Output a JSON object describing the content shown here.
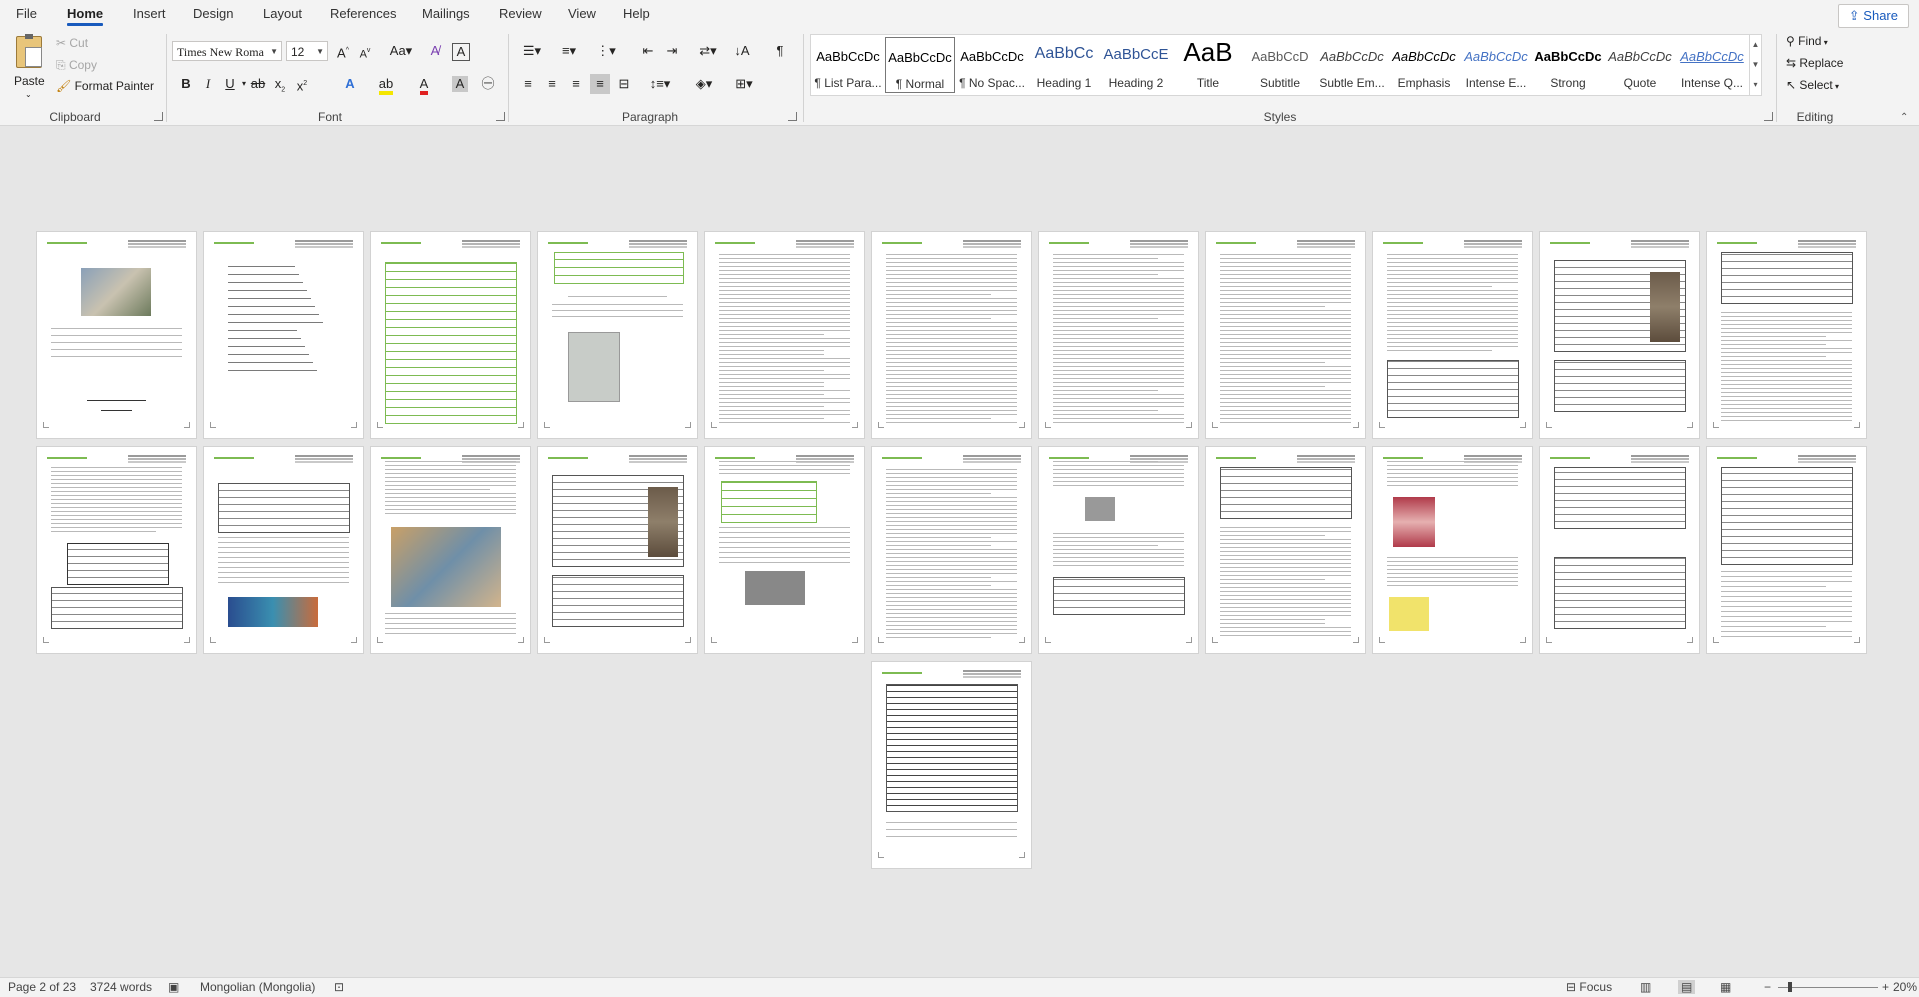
{
  "tabs": [
    "File",
    "Home",
    "Insert",
    "Design",
    "Layout",
    "References",
    "Mailings",
    "Review",
    "View",
    "Help"
  ],
  "active_tab": "Home",
  "share_label": "Share",
  "clipboard": {
    "paste": "Paste",
    "cut": "Cut",
    "copy": "Copy",
    "format_painter": "Format Painter",
    "group": "Clipboard"
  },
  "font": {
    "name": "Times New Roma",
    "size": "12",
    "group": "Font"
  },
  "paragraph": {
    "group": "Paragraph"
  },
  "styles": {
    "group": "Styles",
    "items": [
      {
        "preview": "AaBbCcDc",
        "name": "¶ List Para..."
      },
      {
        "preview": "AaBbCcDc",
        "name": "¶ Normal"
      },
      {
        "preview": "AaBbCcDc",
        "name": "¶ No Spac..."
      },
      {
        "preview": "AaBbCc",
        "name": "Heading 1"
      },
      {
        "preview": "AaBbCcE",
        "name": "Heading 2"
      },
      {
        "preview": "AaB",
        "name": "Title"
      },
      {
        "preview": "AaBbCcD",
        "name": "Subtitle"
      },
      {
        "preview": "AaBbCcDc",
        "name": "Subtle Em..."
      },
      {
        "preview": "AaBbCcDc",
        "name": "Emphasis"
      },
      {
        "preview": "AaBbCcDc",
        "name": "Intense E..."
      },
      {
        "preview": "AaBbCcDc",
        "name": "Strong"
      },
      {
        "preview": "AaBbCcDc",
        "name": "Quote"
      },
      {
        "preview": "AaBbCcDc",
        "name": "Intense Q..."
      }
    ]
  },
  "editing": {
    "find": "Find",
    "replace": "Replace",
    "select": "Select",
    "group": "Editing"
  },
  "status": {
    "page": "Page 2 of 23",
    "words": "3724 words",
    "language": "Mongolian (Mongolia)",
    "focus": "Focus",
    "zoom": "20%"
  },
  "colors": {
    "accent": "#185abd",
    "ribbon": "#f3f3f3",
    "canvas": "#e6e6e6",
    "header_green": "#7dbb52"
  }
}
